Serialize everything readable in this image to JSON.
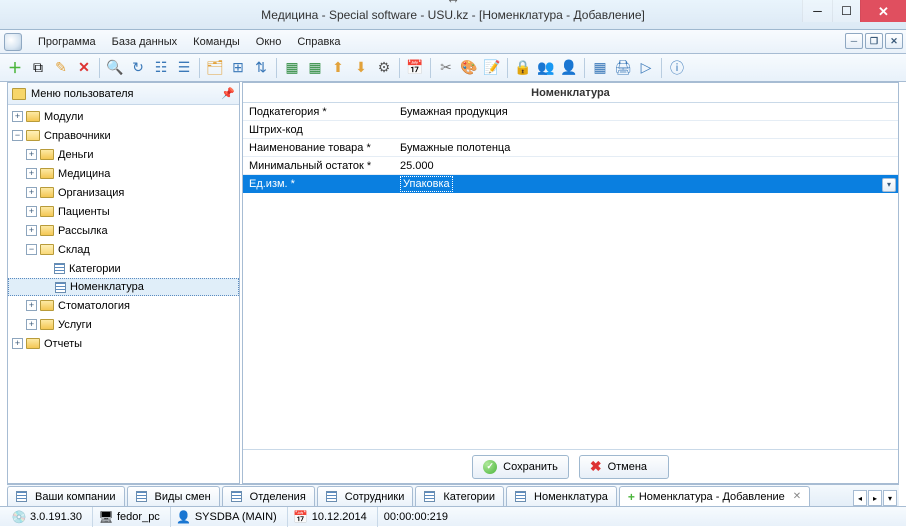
{
  "window": {
    "title": "Медицина - Special software - USU.kz - [Номенклатура - Добавление]"
  },
  "menu": {
    "items": [
      "Программа",
      "База данных",
      "Команды",
      "Окно",
      "Справка"
    ]
  },
  "sidebar": {
    "title": "Меню пользователя",
    "nodes": {
      "modules": "Модули",
      "refs": "Справочники",
      "money": "Деньги",
      "medicine": "Медицина",
      "org": "Организация",
      "patients": "Пациенты",
      "mailing": "Рассылка",
      "warehouse": "Склад",
      "categories": "Категории",
      "nomenclature": "Номенклатура",
      "stomatology": "Стоматология",
      "services": "Услуги",
      "reports": "Отчеты"
    }
  },
  "form": {
    "title": "Номенклатура",
    "rows": {
      "subcat_label": "Подкатегория *",
      "subcat_value": "Бумажная продукция",
      "barcode_label": "Штрих-код",
      "barcode_value": "",
      "name_label": "Наименование товара *",
      "name_value": "Бумажные полотенца",
      "minrem_label": "Минимальный остаток *",
      "minrem_value": "25.000",
      "unit_label": "Ед.изм. *",
      "unit_value": "Упаковка"
    },
    "buttons": {
      "save": "Сохранить",
      "cancel": "Отмена"
    }
  },
  "tabs": {
    "items": [
      "Ваши компании",
      "Виды смен",
      "Отделения",
      "Сотрудники",
      "Категории",
      "Номенклатура"
    ],
    "active": "Номенклатура - Добавление"
  },
  "status": {
    "version": "3.0.191.30",
    "host": "fedor_pc",
    "user": "SYSDBA (MAIN)",
    "date": "10.12.2014",
    "time": "00:00:00:219"
  }
}
